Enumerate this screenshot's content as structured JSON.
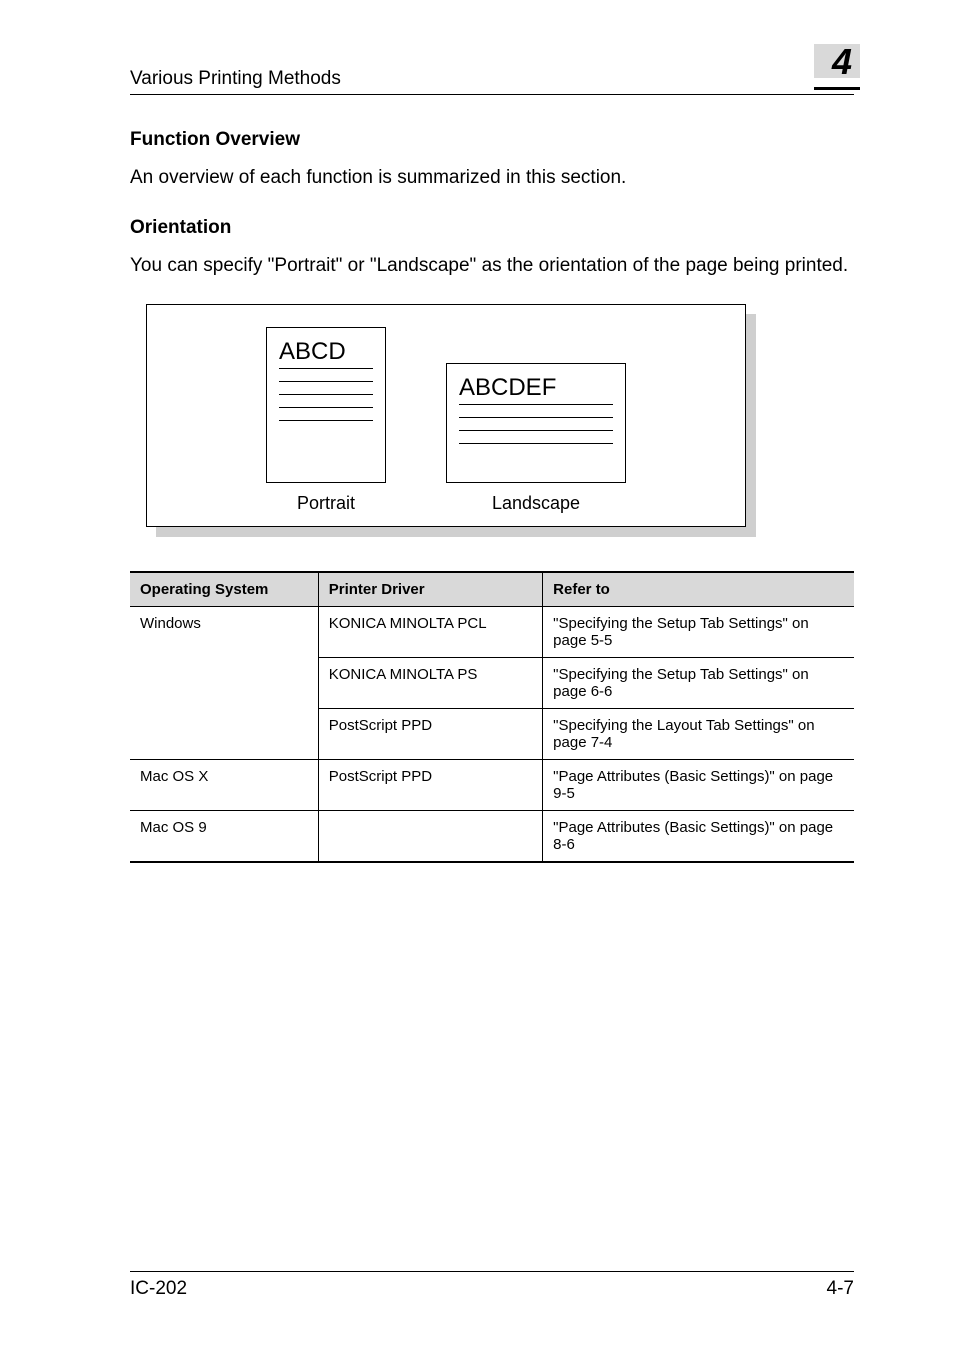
{
  "header": {
    "section_title": "Various Printing Methods",
    "chapter_number": "4"
  },
  "h_function_overview": "Function Overview",
  "p_function_overview": "An overview of each function is summarized in this section.",
  "h_orientation": "Orientation",
  "p_orientation": "You can specify \"Portrait\" or \"Landscape\" as the orientation of the page being printed.",
  "illustration": {
    "portrait_text": "ABCD",
    "portrait_caption": "Portrait",
    "landscape_text": "ABCDEF",
    "landscape_caption": "Landscape"
  },
  "table": {
    "headers": {
      "os": "Operating System",
      "driver": "Printer Driver",
      "refer": "Refer to"
    },
    "rows": [
      {
        "os": "Windows",
        "driver": "KONICA MINOLTA PCL",
        "refer": "\"Specifying the Setup Tab Settings\" on page 5-5"
      },
      {
        "os": "",
        "driver": "KONICA MINOLTA PS",
        "refer": "\"Specifying the Setup Tab Settings\" on page 6-6"
      },
      {
        "os": "",
        "driver": "PostScript PPD",
        "refer": "\"Specifying the Layout Tab Settings\" on page 7-4"
      },
      {
        "os": "Mac OS X",
        "driver": "PostScript PPD",
        "refer": "\"Page Attributes (Basic Settings)\" on page 9-5"
      },
      {
        "os": "Mac OS 9",
        "driver": "",
        "refer": "\"Page Attributes (Basic Settings)\" on page 8-6"
      }
    ]
  },
  "footer": {
    "left": "IC-202",
    "right": "4-7"
  }
}
